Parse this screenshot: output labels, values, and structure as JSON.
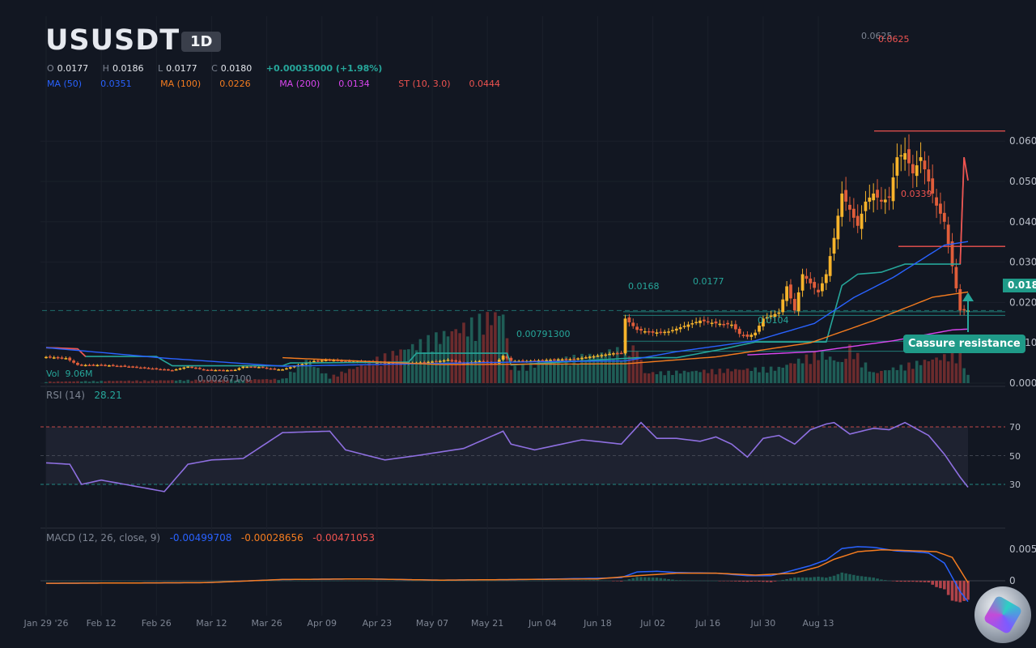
{
  "header": {
    "symbol": "USUSDT",
    "timeframe": "1D",
    "ohlc": {
      "o_key": "O",
      "o": "0.0177",
      "h_key": "H",
      "h": "0.0186",
      "l_key": "L",
      "l": "0.0177",
      "c_key": "C",
      "c": "0.0180",
      "change": "+0.00035000 (+1.98%)"
    }
  },
  "indicators": {
    "ma50": {
      "label": "MA (50)",
      "value": "0.0351",
      "color": "#2962ff"
    },
    "ma100": {
      "label": "MA (100)",
      "value": "0.0226",
      "color": "#f57c1f"
    },
    "ma200": {
      "label": "MA (200)",
      "value": "0.0134",
      "color": "#d946ef"
    },
    "st": {
      "label": "ST (10, 3.0)",
      "value": "0.0444",
      "color": "#ef5350"
    }
  },
  "annotations": {
    "high_a": "0.0625",
    "high_b": "0.0625",
    "low_marker": "0.0339",
    "level_0168": "0.0168",
    "level_0177": "0.0177",
    "level_0104": "0.0104",
    "level_00791": "0.00791300",
    "low_all": "0.00267100",
    "badge": "Cassure resistance",
    "price_tag": "0.0180"
  },
  "volume": {
    "label": "Vol",
    "value": "9.06M"
  },
  "rsi": {
    "label": "RSI (14)",
    "value": "28.21",
    "levels": [
      "70",
      "50",
      "30"
    ]
  },
  "macd": {
    "label": "MACD (12, 26, close, 9)",
    "macd": "-0.00499708",
    "signal": "-0.00028656",
    "hist": "-0.00471053"
  },
  "colors": {
    "up": "#f7b32b",
    "down": "#e05d3a",
    "accent": "#26a69a"
  },
  "chart_data": {
    "type": "candlestick",
    "price_axis": {
      "ticks": [
        "0.060",
        "0.050",
        "0.040",
        "0.030",
        "0.020",
        "0.010",
        "0.000"
      ],
      "ylim": [
        0,
        0.0675
      ]
    },
    "x_ticks": [
      "Jan 29 '26",
      "Feb 12",
      "Feb 26",
      "Mar 12",
      "Mar 26",
      "Apr 09",
      "Apr 23",
      "May 07",
      "May 21",
      "Jun 04",
      "Jun 18",
      "Jul 02",
      "Jul 16",
      "Jul 30",
      "Aug 13"
    ],
    "macd_axis": {
      "ticks": [
        "0.005",
        "0"
      ]
    },
    "close_anchors": [
      [
        0,
        0.0065
      ],
      [
        5,
        0.0062
      ],
      [
        8,
        0.0045
      ],
      [
        14,
        0.0045
      ],
      [
        20,
        0.0042
      ],
      [
        26,
        0.0037
      ],
      [
        32,
        0.0032
      ],
      [
        36,
        0.0041
      ],
      [
        40,
        0.0033
      ],
      [
        46,
        0.0032
      ],
      [
        48,
        0.0033
      ],
      [
        50,
        0.0041
      ],
      [
        54,
        0.004
      ],
      [
        58,
        0.0034
      ],
      [
        60,
        0.0034
      ],
      [
        64,
        0.0045
      ],
      [
        68,
        0.0055
      ],
      [
        72,
        0.0058
      ],
      [
        76,
        0.0054
      ],
      [
        82,
        0.0053
      ],
      [
        90,
        0.0048
      ],
      [
        96,
        0.0052
      ],
      [
        100,
        0.0055
      ],
      [
        102,
        0.0058
      ],
      [
        106,
        0.0049
      ],
      [
        110,
        0.0055
      ],
      [
        114,
        0.0048
      ],
      [
        116,
        0.0068
      ],
      [
        118,
        0.0055
      ],
      [
        122,
        0.0055
      ],
      [
        128,
        0.0058
      ],
      [
        134,
        0.006
      ],
      [
        140,
        0.0068
      ],
      [
        144,
        0.0074
      ],
      [
        146,
        0.0075
      ],
      [
        147,
        0.016
      ],
      [
        150,
        0.0132
      ],
      [
        154,
        0.0125
      ],
      [
        158,
        0.0128
      ],
      [
        162,
        0.0142
      ],
      [
        166,
        0.0155
      ],
      [
        170,
        0.0148
      ],
      [
        174,
        0.0145
      ],
      [
        176,
        0.0122
      ],
      [
        178,
        0.0115
      ],
      [
        180,
        0.0125
      ],
      [
        182,
        0.016
      ],
      [
        186,
        0.0175
      ],
      [
        188,
        0.024
      ],
      [
        190,
        0.018
      ],
      [
        192,
        0.027
      ],
      [
        196,
        0.0225
      ],
      [
        198,
        0.027
      ],
      [
        200,
        0.036
      ],
      [
        202,
        0.047
      ],
      [
        204,
        0.043
      ],
      [
        206,
        0.039
      ],
      [
        208,
        0.045
      ],
      [
        210,
        0.047
      ],
      [
        212,
        0.045
      ],
      [
        214,
        0.046
      ],
      [
        216,
        0.056
      ],
      [
        218,
        0.057
      ],
      [
        220,
        0.052
      ],
      [
        222,
        0.056
      ],
      [
        224,
        0.05
      ],
      [
        226,
        0.044
      ],
      [
        228,
        0.04
      ],
      [
        230,
        0.029
      ],
      [
        232,
        0.018
      ],
      [
        234,
        0.018
      ]
    ],
    "rsi_anchors": [
      [
        0,
        45
      ],
      [
        6,
        44
      ],
      [
        9,
        30
      ],
      [
        14,
        33
      ],
      [
        20,
        30
      ],
      [
        26,
        27
      ],
      [
        30,
        25
      ],
      [
        36,
        44
      ],
      [
        42,
        47
      ],
      [
        50,
        48
      ],
      [
        60,
        66
      ],
      [
        72,
        67
      ],
      [
        76,
        54
      ],
      [
        86,
        47
      ],
      [
        94,
        50
      ],
      [
        106,
        55
      ],
      [
        116,
        67
      ],
      [
        118,
        58
      ],
      [
        124,
        54
      ],
      [
        136,
        61
      ],
      [
        146,
        58
      ],
      [
        151,
        73
      ],
      [
        155,
        62
      ],
      [
        160,
        62
      ],
      [
        166,
        60
      ],
      [
        170,
        63
      ],
      [
        174,
        58
      ],
      [
        178,
        49
      ],
      [
        182,
        62
      ],
      [
        186,
        64
      ],
      [
        190,
        58
      ],
      [
        194,
        68
      ],
      [
        198,
        72
      ],
      [
        200,
        73
      ],
      [
        204,
        65
      ],
      [
        210,
        69
      ],
      [
        214,
        68
      ],
      [
        218,
        73
      ],
      [
        222,
        67
      ],
      [
        224,
        64
      ],
      [
        228,
        51
      ],
      [
        232,
        35
      ],
      [
        234,
        28
      ]
    ],
    "macd_anchors": [
      [
        0,
        -0.0004
      ],
      [
        40,
        -0.0003
      ],
      [
        60,
        0.0002
      ],
      [
        80,
        0.0003
      ],
      [
        100,
        0.0001
      ],
      [
        120,
        0.0002
      ],
      [
        140,
        0.0004
      ],
      [
        146,
        0.0005
      ],
      [
        150,
        0.0014
      ],
      [
        155,
        0.0015
      ],
      [
        160,
        0.0013
      ],
      [
        170,
        0.0012
      ],
      [
        178,
        0.0008
      ],
      [
        184,
        0.0008
      ],
      [
        188,
        0.0014
      ],
      [
        194,
        0.0024
      ],
      [
        198,
        0.0033
      ],
      [
        202,
        0.0051
      ],
      [
        206,
        0.0054
      ],
      [
        210,
        0.0053
      ],
      [
        216,
        0.0047
      ],
      [
        220,
        0.0046
      ],
      [
        224,
        0.0044
      ],
      [
        228,
        0.0028
      ],
      [
        232,
        -0.0017
      ],
      [
        234,
        -0.0033
      ]
    ],
    "signal_anchors": [
      [
        0,
        -0.0004
      ],
      [
        40,
        -0.0003
      ],
      [
        60,
        0.0002
      ],
      [
        80,
        0.0003
      ],
      [
        100,
        0.0001
      ],
      [
        120,
        0.0002
      ],
      [
        140,
        0.0003
      ],
      [
        150,
        0.0008
      ],
      [
        160,
        0.0012
      ],
      [
        170,
        0.0012
      ],
      [
        180,
        0.0009
      ],
      [
        190,
        0.0012
      ],
      [
        196,
        0.0022
      ],
      [
        200,
        0.0034
      ],
      [
        206,
        0.0046
      ],
      [
        212,
        0.0049
      ],
      [
        218,
        0.0048
      ],
      [
        226,
        0.0046
      ],
      [
        230,
        0.0037
      ],
      [
        234,
        -0.0003
      ]
    ],
    "ma50_anchors": [
      [
        0,
        0.0088
      ],
      [
        30,
        0.0062
      ],
      [
        60,
        0.0042
      ],
      [
        100,
        0.0049
      ],
      [
        130,
        0.0054
      ],
      [
        147,
        0.0055
      ],
      [
        160,
        0.0078
      ],
      [
        180,
        0.0105
      ],
      [
        195,
        0.0148
      ],
      [
        205,
        0.0212
      ],
      [
        215,
        0.0262
      ],
      [
        228,
        0.0342
      ],
      [
        234,
        0.0351
      ]
    ],
    "ma100_anchors": [
      [
        60,
        0.0063
      ],
      [
        100,
        0.0046
      ],
      [
        147,
        0.0048
      ],
      [
        170,
        0.0065
      ],
      [
        194,
        0.01
      ],
      [
        210,
        0.0155
      ],
      [
        225,
        0.0213
      ],
      [
        234,
        0.0226
      ]
    ],
    "ma200_anchors": [
      [
        178,
        0.007
      ],
      [
        195,
        0.0078
      ],
      [
        215,
        0.0105
      ],
      [
        230,
        0.0132
      ],
      [
        234,
        0.0134
      ]
    ],
    "supertrend_anchors": [
      [
        0,
        0.0088
      ],
      [
        8,
        0.0085
      ],
      [
        10,
        0.0066
      ],
      [
        28,
        0.0066
      ],
      [
        32,
        0.0043
      ],
      [
        60,
        0.0043
      ],
      [
        62,
        0.005
      ],
      [
        92,
        0.0052
      ],
      [
        94,
        0.0074
      ],
      [
        117,
        0.0074
      ],
      [
        118,
        0.0045
      ],
      [
        150,
        0.0063
      ],
      [
        160,
        0.0063
      ],
      [
        172,
        0.0085
      ],
      [
        180,
        0.0102
      ],
      [
        198,
        0.0102
      ],
      [
        202,
        0.0242
      ],
      [
        206,
        0.027
      ],
      [
        212,
        0.0275
      ],
      [
        218,
        0.0295
      ],
      [
        232,
        0.0295
      ],
      [
        233,
        0.056
      ],
      [
        235,
        0.0445
      ]
    ],
    "volume_anchors": [
      [
        0,
        0.3
      ],
      [
        60,
        0.8
      ],
      [
        66,
        4.5
      ],
      [
        72,
        1.2
      ],
      [
        116,
        14
      ],
      [
        118,
        3
      ],
      [
        150,
        7
      ],
      [
        152,
        2
      ],
      [
        186,
        3
      ],
      [
        196,
        6
      ],
      [
        202,
        4
      ],
      [
        204,
        7
      ],
      [
        210,
        2
      ],
      [
        232,
        6
      ],
      [
        234,
        1.5
      ]
    ],
    "n_bars": 235,
    "series": [
      {
        "name": "MA (50)",
        "value": 0.0351
      },
      {
        "name": "MA (100)",
        "value": 0.0226
      },
      {
        "name": "MA (200)",
        "value": 0.0134
      },
      {
        "name": "ST (10, 3.0)",
        "value": 0.0444
      }
    ]
  }
}
